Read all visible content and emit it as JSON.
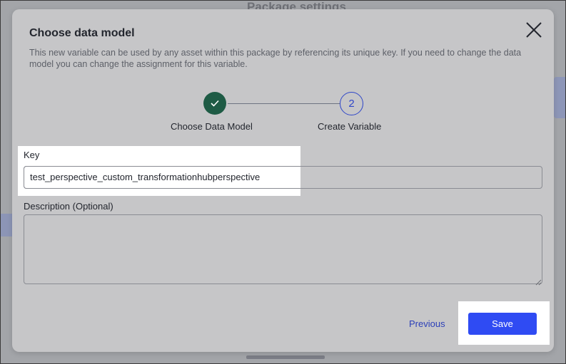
{
  "background": {
    "heading": "Package settings"
  },
  "dialog": {
    "title": "Choose data model",
    "description": "This new variable can be used by any asset within this package by referencing its unique key. If you need to change the data model you can change the assignment for this variable.",
    "close_icon": "close-icon",
    "stepper": {
      "steps": [
        {
          "label": "Choose Data Model",
          "state": "completed",
          "icon": "check-icon"
        },
        {
          "label": "Create Variable",
          "number": "2",
          "state": "current"
        }
      ]
    },
    "key": {
      "label": "Key",
      "value": "test_perspective_custom_transformationhubperspective"
    },
    "description_field": {
      "label": "Description (Optional)",
      "value": ""
    },
    "footer": {
      "previous_label": "Previous",
      "save_label": "Save"
    }
  },
  "colors": {
    "overlay": "#a3a5a9",
    "dialog_bg": "#c6c6c8",
    "step_completed": "#1e5b45",
    "step_current": "#2f46c8",
    "primary_button": "#2f4bf3",
    "link": "#2c40b8"
  }
}
